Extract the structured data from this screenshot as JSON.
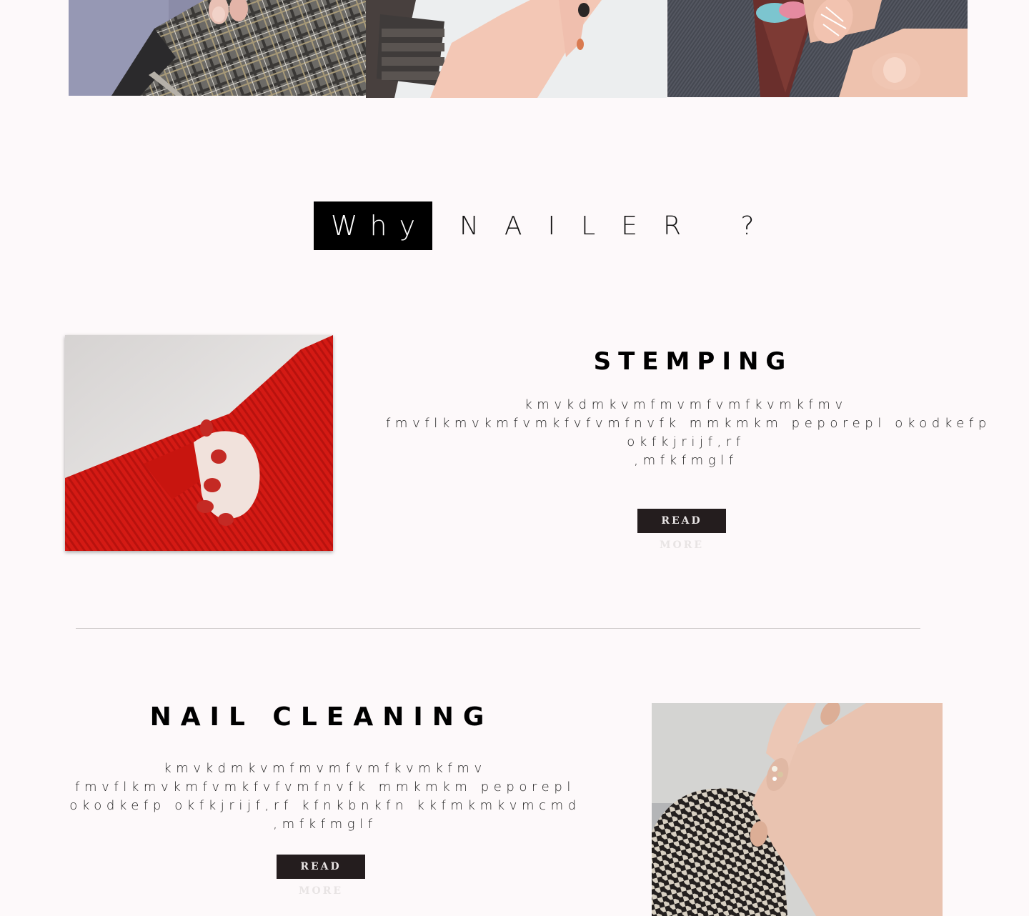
{
  "colors": {
    "page_background": "#fdf9fa",
    "heading_box": "#000000",
    "button_background": "#241d1e",
    "button_text": "#e8e4e4",
    "divider": "#cfcbcb"
  },
  "gallery": {
    "images": [
      {
        "subject": "hand with nude manicure on plaid fabric"
      },
      {
        "subject": "hand with watch and nail art on grey background"
      },
      {
        "subject": "nude manicure on denim with ice cream patch"
      }
    ]
  },
  "why": {
    "highlight": "Why",
    "rest": "NAILER ?"
  },
  "features": [
    {
      "title": "STEMPING",
      "lines": [
        "kmvkdmkvmfmvmfvmfkvmkfmv",
        "fmvflkmvkmfvmkfvfvmfnvfk mmkmkm peporepl okodkefp",
        "okfkjrijf,rf",
        ",mfkfmglf"
      ],
      "button": "READ MORE",
      "image_subject": "hand with red nails in red sweater"
    },
    {
      "title": "NAIL CLEANING",
      "lines": [
        "kmvkdmkvmfmvmfvmfkvmkfmv",
        "fmvflkmvkmfvmkfvfvmfnvfk mmkmkm peporepl",
        "okodkefp okfkjrijf,rf kfnkbnkfn kkfmkmkvmcmd",
        ",mfkfmglf"
      ],
      "button": "READ MORE",
      "image_subject": "hand with nude nails on houndstooth fabric"
    }
  ]
}
